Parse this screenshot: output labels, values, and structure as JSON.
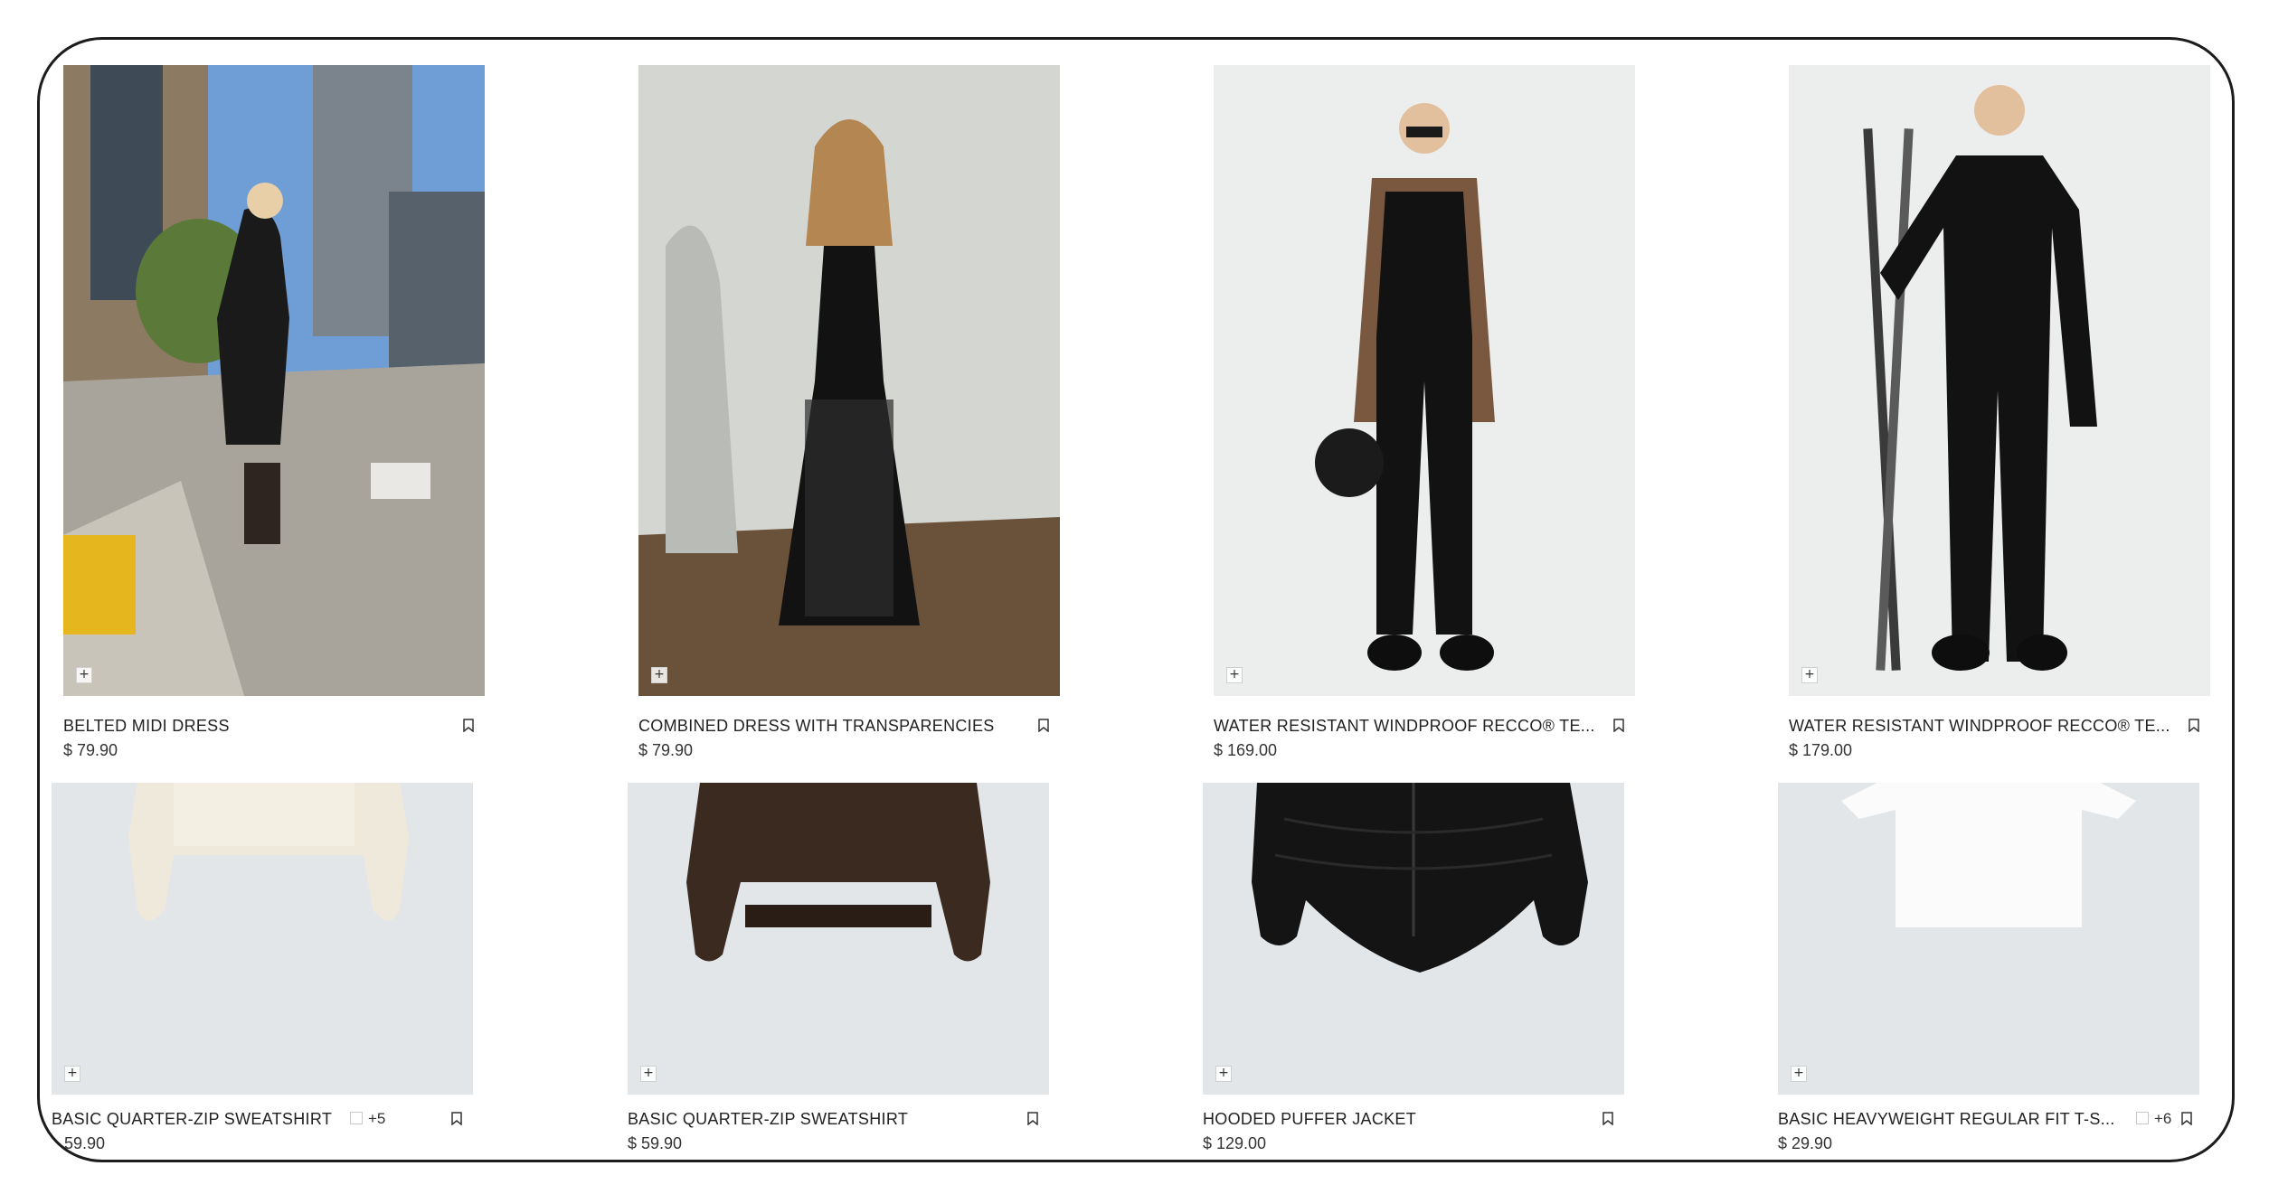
{
  "products": [
    {
      "name": "BELTED MIDI DRESS",
      "price": "$ 79.90",
      "image": "woman in black knit midi dress walking on city street",
      "add_icon": "+",
      "bookmark_icon": "bookmark-icon"
    },
    {
      "name": "COMBINED DRESS WITH TRANSPARENCIES",
      "price": "$ 79.90",
      "image": "woman in black strapless dress with sheer skirt",
      "add_icon": "+",
      "bookmark_icon": "bookmark-icon"
    },
    {
      "name": "WATER RESISTANT WINDPROOF RECCO® TE...",
      "price": "$ 169.00",
      "image": "woman in black ski overalls holding a helmet",
      "add_icon": "+",
      "bookmark_icon": "bookmark-icon"
    },
    {
      "name": "WATER RESISTANT WINDPROOF RECCO® TE...",
      "price": "$ 179.00",
      "image": "woman in black ski suit holding skis",
      "add_icon": "+",
      "bookmark_icon": "bookmark-icon"
    },
    {
      "name": "BASIC QUARTER-ZIP SWEATSHIRT",
      "more_colors": "+5",
      "price": "59.90",
      "image": "cream sweatshirt on grey background",
      "add_icon": "+",
      "bookmark_icon": "bookmark-icon"
    },
    {
      "name": "BASIC QUARTER-ZIP SWEATSHIRT",
      "price": "$ 59.90",
      "image": "brown sweatshirt on grey background",
      "add_icon": "+",
      "bookmark_icon": "bookmark-icon"
    },
    {
      "name": "HOODED PUFFER JACKET",
      "price": "$ 129.00",
      "image": "black puffer jacket on grey background",
      "add_icon": "+",
      "bookmark_icon": "bookmark-icon"
    },
    {
      "name": "BASIC HEAVYWEIGHT REGULAR FIT T-S...",
      "more_colors": "+6",
      "price": "$ 29.90",
      "image": "white t-shirt on grey background",
      "add_icon": "+",
      "bookmark_icon": "bookmark-icon"
    }
  ],
  "colors": {
    "frame_border": "#1c1c1c",
    "studio_grey": "#e3e6e9",
    "text": "#222222"
  }
}
